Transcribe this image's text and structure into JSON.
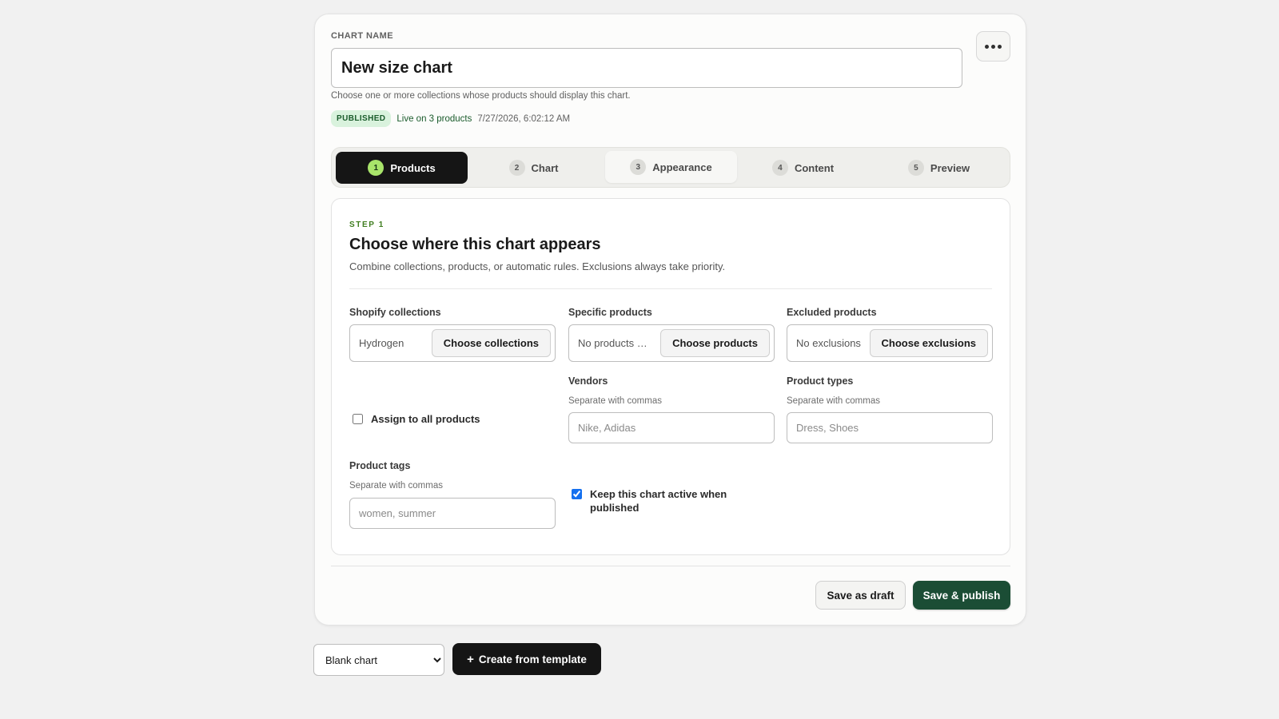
{
  "header": {
    "chart_name_label": "CHART NAME",
    "chart_name_value": "New size chart",
    "help_text": "Choose one or more collections whose products should display this chart.",
    "status_badge": "PUBLISHED",
    "live_text": "Live on 3 products",
    "timestamp": "7/27/2026, 6:02:12 AM"
  },
  "steps": [
    {
      "num": "1",
      "label": "Products"
    },
    {
      "num": "2",
      "label": "Chart"
    },
    {
      "num": "3",
      "label": "Appearance"
    },
    {
      "num": "4",
      "label": "Content"
    },
    {
      "num": "5",
      "label": "Preview"
    }
  ],
  "panel": {
    "kicker": "STEP 1",
    "title": "Choose where this chart appears",
    "subtitle": "Combine collections, products, or automatic rules. Exclusions always take priority."
  },
  "fields": {
    "collections": {
      "label": "Shopify collections",
      "value": "Hydrogen",
      "button": "Choose collections"
    },
    "products": {
      "label": "Specific products",
      "value": "No products selected",
      "button": "Choose products"
    },
    "exclusions": {
      "label": "Excluded products",
      "value": "No exclusions",
      "button": "Choose exclusions"
    },
    "vendors": {
      "label": "Vendors",
      "hint": "Separate with commas",
      "placeholder": "Nike, Adidas"
    },
    "product_types": {
      "label": "Product types",
      "hint": "Separate with commas",
      "placeholder": "Dress, Shoes"
    },
    "product_tags": {
      "label": "Product tags",
      "hint": "Separate with commas",
      "placeholder": "women, summer"
    },
    "assign_all": {
      "label": "Assign to all products",
      "checked": false
    },
    "keep_active": {
      "label": "Keep this chart active when published",
      "checked": true
    }
  },
  "footer": {
    "draft_label": "Save as draft",
    "publish_label": "Save & publish"
  },
  "bottom": {
    "template_selected": "Blank chart",
    "create_label": "Create from template"
  },
  "colors": {
    "accent_dark": "#151515",
    "publish_green": "#1b4d35",
    "badge_bg": "#d9f2dd",
    "step_active_num": "#a8e46a",
    "kicker_green": "#3f7d1f"
  }
}
